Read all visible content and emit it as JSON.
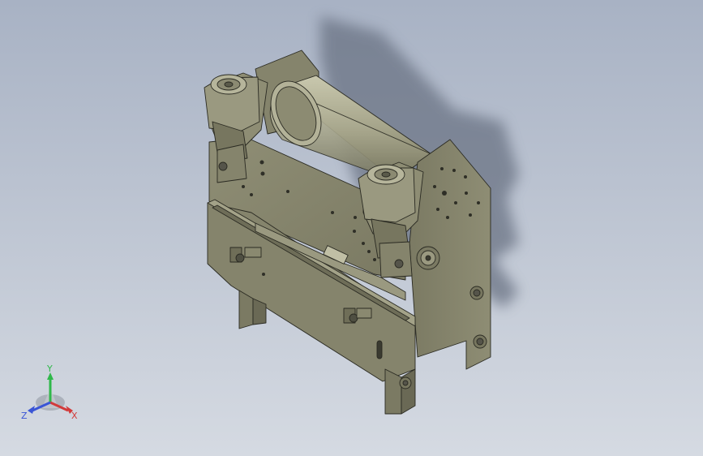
{
  "viewport": {
    "background_top": "#a8b2c4",
    "background_bottom": "#d5dae2",
    "model_color": "#8a8970",
    "model_shade": "#6c6b56",
    "model_light": "#a3a288",
    "shadow_color": "#6b7486"
  },
  "triad": {
    "x_label": "X",
    "y_label": "Y",
    "z_label": "Z",
    "x_color": "#d23a3a",
    "y_color": "#2fb84a",
    "z_color": "#3a55d6"
  }
}
